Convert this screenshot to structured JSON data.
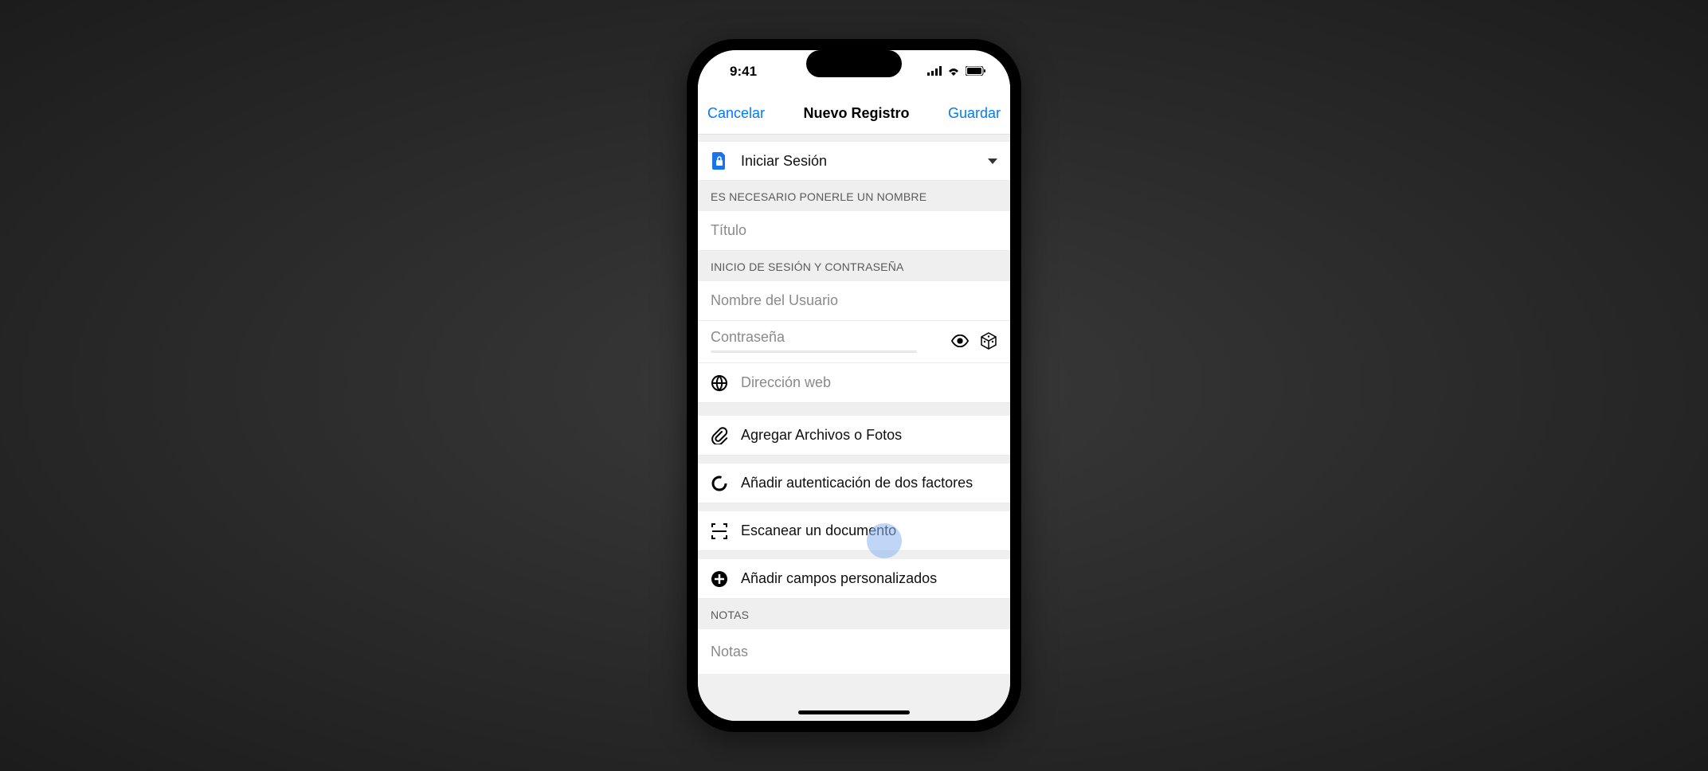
{
  "status_bar": {
    "time": "9:41"
  },
  "nav": {
    "cancel": "Cancelar",
    "title": "Nuevo Registro",
    "save": "Guardar"
  },
  "type_row": {
    "label": "Iniciar Sesión"
  },
  "sections": {
    "name_header": "ES NECESARIO PONERLE UN NOMBRE",
    "title_placeholder": "Título",
    "login_header": "INICIO DE SESIÓN Y CONTRASEÑA",
    "username_placeholder": "Nombre del Usuario",
    "password_placeholder": "Contraseña",
    "web_placeholder": "Dirección web",
    "attach": "Agregar Archivos o Fotos",
    "twofa": "Añadir autenticación de dos factores",
    "scan": "Escanear un documento",
    "custom": "Añadir campos personalizados",
    "notes_header": "NOTAS",
    "notes_placeholder": "Notas"
  }
}
